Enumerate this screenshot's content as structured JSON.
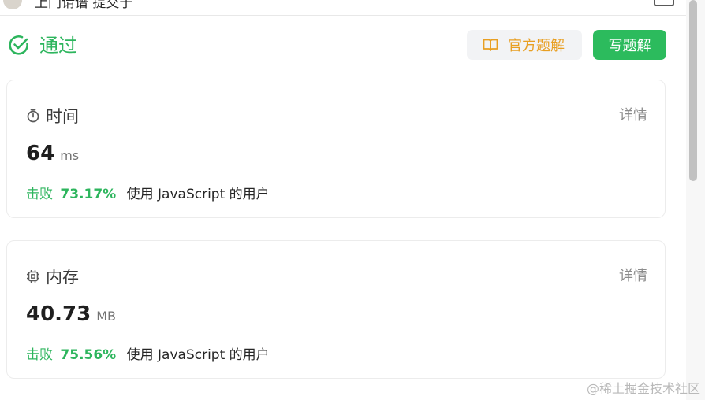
{
  "header": {
    "author_text": "上门请谱 提交于"
  },
  "status": {
    "text": "通过",
    "color": "#2db55d"
  },
  "toolbar": {
    "official_solution_label": "官方题解",
    "write_solution_label": "写题解"
  },
  "time_card": {
    "title": "时间",
    "detail_label": "详情",
    "value": "64",
    "unit": "ms",
    "beat_prefix": "击败",
    "beat_percent": "73.17%",
    "beat_suffix": "使用 JavaScript 的用户"
  },
  "memory_card": {
    "title": "内存",
    "detail_label": "详情",
    "value": "40.73",
    "unit": "MB",
    "beat_prefix": "击败",
    "beat_percent": "75.56%",
    "beat_suffix": "使用 JavaScript 的用户"
  },
  "watermark": "@稀土掘金技术社区",
  "icons": {
    "status": "check-circle-icon",
    "official": "book-open-icon",
    "time": "stopwatch-icon",
    "memory": "chip-icon"
  },
  "colors": {
    "accent_green": "#2cbb5d",
    "official_orange": "#e89f22"
  }
}
